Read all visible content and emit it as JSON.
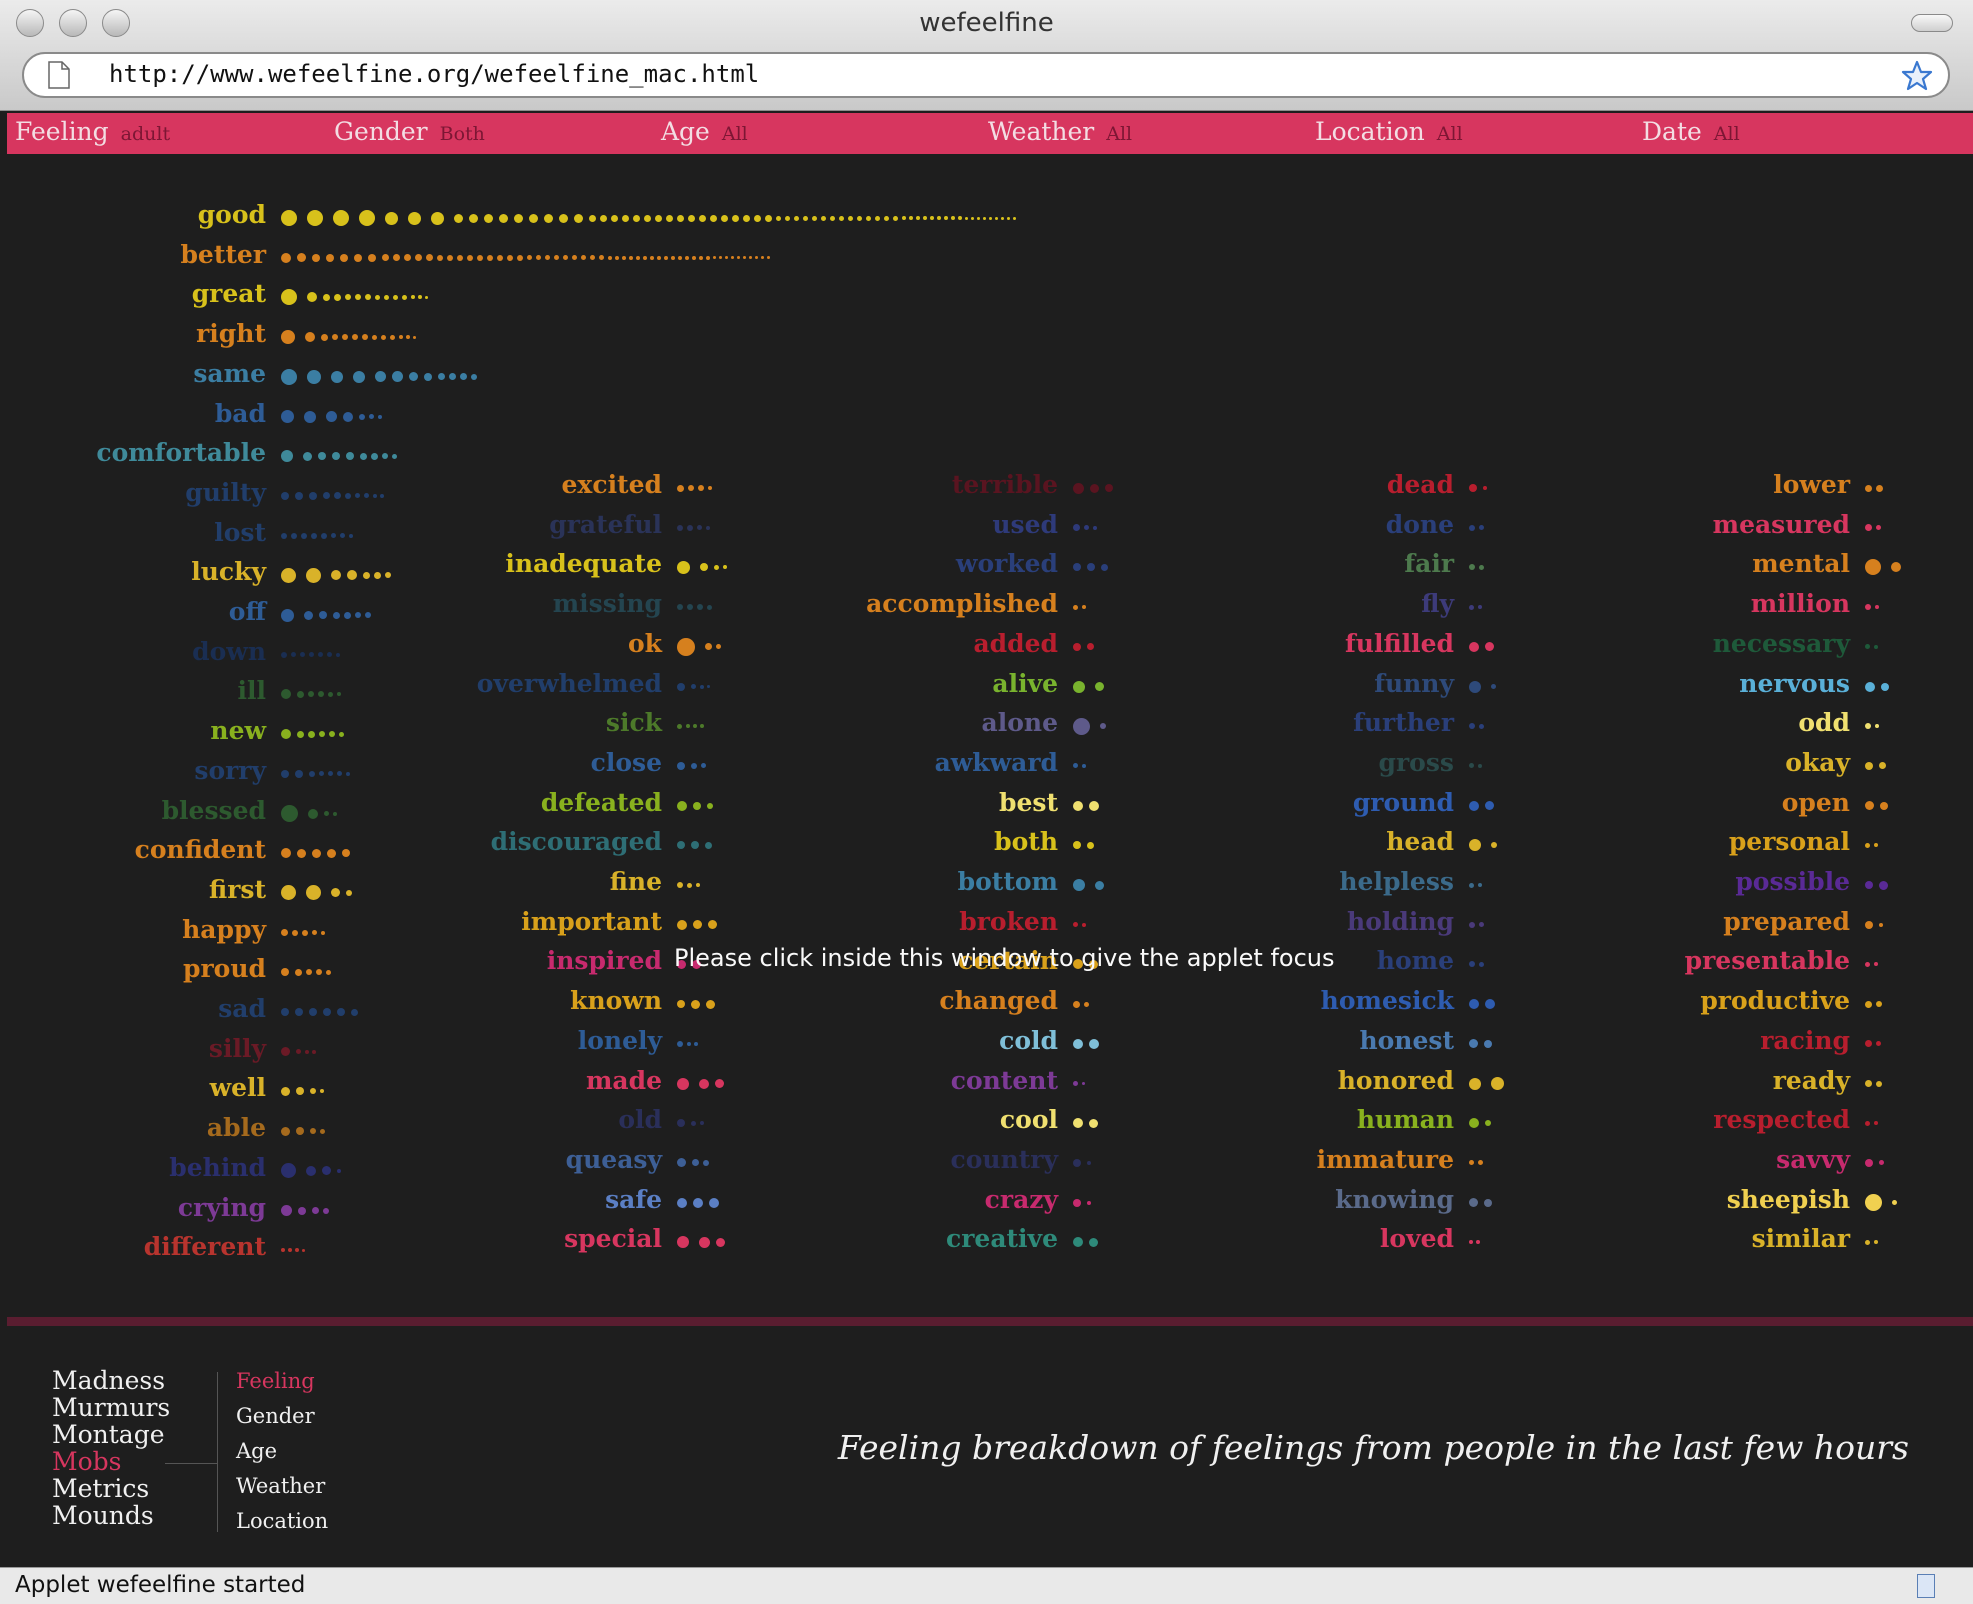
{
  "window": {
    "title": "wefeelfine",
    "url": "http://www.wefeelfine.org/wefeelfine_mac.html"
  },
  "filters": [
    {
      "label": "Feeling",
      "value": "adult"
    },
    {
      "label": "Gender",
      "value": "Both"
    },
    {
      "label": "Age",
      "value": "All"
    },
    {
      "label": "Weather",
      "value": "All"
    },
    {
      "label": "Location",
      "value": "All"
    },
    {
      "label": "Date",
      "value": "All"
    }
  ],
  "feelings": [
    {
      "word": "good",
      "color": "#d8c11b",
      "dots": [
        16,
        16,
        16,
        16,
        13,
        13,
        13,
        9,
        9,
        9,
        9,
        9,
        9,
        9,
        9,
        9,
        7,
        7,
        7,
        7,
        7,
        7,
        7,
        7,
        7,
        7,
        7,
        7,
        7,
        7,
        7,
        7,
        7,
        5,
        5,
        5,
        5,
        5,
        5,
        5,
        5,
        5,
        5,
        5,
        5,
        5,
        5,
        4,
        4,
        4,
        4,
        4,
        4,
        4,
        4,
        4,
        3,
        3,
        3,
        3,
        3,
        3,
        3,
        3,
        3
      ]
    },
    {
      "word": "better",
      "color": "#d6801e",
      "dots": [
        10,
        9,
        8,
        8,
        8,
        8,
        8,
        7,
        7,
        7,
        7,
        7,
        6,
        6,
        6,
        6,
        6,
        6,
        6,
        6,
        6,
        5,
        5,
        5,
        5,
        5,
        5,
        5,
        5,
        5,
        4,
        4,
        4,
        4,
        4,
        4,
        4,
        4,
        4,
        4,
        4,
        4,
        4,
        4,
        4,
        3,
        3,
        3,
        3,
        3,
        3,
        3,
        3,
        3,
        3
      ]
    },
    {
      "word": "great",
      "color": "#d8c11b",
      "dots": [
        16,
        10,
        7,
        7,
        6,
        6,
        6,
        5,
        5,
        5,
        5,
        4,
        4,
        3
      ]
    },
    {
      "word": "right",
      "color": "#d6801e",
      "dots": [
        14,
        10,
        7,
        6,
        6,
        6,
        6,
        5,
        5,
        5,
        4,
        4,
        3
      ]
    },
    {
      "word": "same",
      "color": "#3b7ea3",
      "dots": [
        16,
        14,
        12,
        12,
        11,
        11,
        9,
        8,
        7,
        7,
        7,
        6
      ]
    },
    {
      "word": "bad",
      "color": "#2e5c96",
      "dots": [
        13,
        12,
        11,
        10,
        6,
        5,
        4
      ]
    },
    {
      "word": "comfortable",
      "color": "#3f8a9a",
      "dots": [
        12,
        9,
        8,
        8,
        8,
        7,
        7,
        6,
        5
      ]
    },
    {
      "word": "guilty",
      "color": "#213e6b",
      "dots": [
        8,
        8,
        8,
        7,
        7,
        6,
        5,
        5,
        4,
        4
      ]
    },
    {
      "word": "lost",
      "color": "#213e6b",
      "dots": [
        6,
        6,
        6,
        6,
        6,
        5,
        5,
        4
      ]
    },
    {
      "word": "lucky",
      "color": "#d9b229",
      "dots": [
        15,
        15,
        10,
        10,
        7,
        7,
        6
      ]
    },
    {
      "word": "off",
      "color": "#2e5c96",
      "dots": [
        13,
        9,
        8,
        7,
        7,
        6,
        6
      ]
    },
    {
      "word": "down",
      "color": "#1a2e52",
      "dots": [
        6,
        5,
        5,
        5,
        5,
        5,
        4
      ]
    },
    {
      "word": "ill",
      "color": "#2d5a2f",
      "dots": [
        10,
        7,
        6,
        6,
        5,
        4
      ]
    },
    {
      "word": "new",
      "color": "#89b11e",
      "dots": [
        10,
        7,
        7,
        6,
        6,
        5
      ]
    },
    {
      "word": "sorry",
      "color": "#213e6b",
      "dots": [
        8,
        8,
        6,
        5,
        5,
        5,
        4
      ]
    },
    {
      "word": "blessed",
      "color": "#2d5a2f",
      "dots": [
        17,
        10,
        5,
        4
      ]
    },
    {
      "word": "confident",
      "color": "#d6801e",
      "dots": [
        10,
        9,
        9,
        9,
        8
      ]
    },
    {
      "word": "first",
      "color": "#d9b229",
      "dots": [
        15,
        15,
        9,
        6
      ]
    },
    {
      "word": "happy",
      "color": "#d6801e",
      "dots": [
        7,
        6,
        6,
        5,
        4
      ]
    },
    {
      "word": "proud",
      "color": "#d6801e",
      "dots": [
        8,
        7,
        6,
        6,
        5
      ]
    },
    {
      "word": "sad",
      "color": "#213e6b",
      "dots": [
        8,
        8,
        8,
        8,
        8,
        7
      ]
    },
    {
      "word": "silly",
      "color": "#6b1a26",
      "dots": [
        9,
        5,
        4,
        4
      ]
    },
    {
      "word": "well",
      "color": "#d9b229",
      "dots": [
        9,
        8,
        6,
        4
      ]
    },
    {
      "word": "able",
      "color": "#a56a1d",
      "dots": [
        9,
        8,
        6,
        5
      ]
    },
    {
      "word": "behind",
      "color": "#2a2f6e",
      "dots": [
        15,
        10,
        9,
        4
      ]
    },
    {
      "word": "crying",
      "color": "#7d3a96",
      "dots": [
        11,
        8,
        7,
        6
      ]
    },
    {
      "word": "different",
      "color": "#b8342e",
      "dots": [
        4,
        4,
        4,
        3
      ]
    },
    {
      "word": "excited",
      "color": "#d6801e",
      "dots": [
        7,
        6,
        6,
        4
      ]
    },
    {
      "word": "grateful",
      "color": "#2a3358",
      "dots": [
        6,
        6,
        5,
        4
      ]
    },
    {
      "word": "inadequate",
      "color": "#d8c11b",
      "dots": [
        13,
        8,
        5,
        4
      ]
    },
    {
      "word": "missing",
      "color": "#244550",
      "dots": [
        6,
        6,
        6,
        5
      ]
    },
    {
      "word": "ok",
      "color": "#d6801e",
      "dots": [
        18,
        7,
        5
      ]
    },
    {
      "word": "overwhelmed",
      "color": "#213e6b",
      "dots": [
        8,
        5,
        4,
        3
      ]
    },
    {
      "word": "sick",
      "color": "#4d7a2a",
      "dots": [
        5,
        4,
        4,
        4
      ]
    },
    {
      "word": "close",
      "color": "#2e5c96",
      "dots": [
        8,
        6,
        5
      ]
    },
    {
      "word": "defeated",
      "color": "#89b11e",
      "dots": [
        10,
        8,
        6
      ]
    },
    {
      "word": "discouraged",
      "color": "#2e6e75",
      "dots": [
        8,
        8,
        7
      ]
    },
    {
      "word": "fine",
      "color": "#d9b229",
      "dots": [
        6,
        5,
        4
      ]
    },
    {
      "word": "important",
      "color": "#d9a11b",
      "dots": [
        10,
        9,
        9
      ]
    },
    {
      "word": "inspired",
      "color": "#c72a6e",
      "dots": [
        9,
        9
      ]
    },
    {
      "word": "known",
      "color": "#d9a11b",
      "dots": [
        8,
        9,
        9
      ]
    },
    {
      "word": "lonely",
      "color": "#2e5c96",
      "dots": [
        6,
        4,
        4
      ]
    },
    {
      "word": "made",
      "color": "#d7365f",
      "dots": [
        12,
        10,
        9
      ]
    },
    {
      "word": "old",
      "color": "#2a2f5a",
      "dots": [
        8,
        5,
        4
      ]
    },
    {
      "word": "queasy",
      "color": "#3d5f96",
      "dots": [
        9,
        7,
        6
      ]
    },
    {
      "word": "safe",
      "color": "#5b7fc4",
      "dots": [
        10,
        10,
        10
      ]
    },
    {
      "word": "special",
      "color": "#d7365f",
      "dots": [
        12,
        11,
        9
      ]
    },
    {
      "word": "terrible",
      "color": "#5a1420",
      "dots": [
        11,
        9,
        8
      ]
    },
    {
      "word": "used",
      "color": "#2e3a7a",
      "dots": [
        7,
        5,
        4
      ]
    },
    {
      "word": "worked",
      "color": "#2a3f7a",
      "dots": [
        8,
        8,
        7
      ]
    },
    {
      "word": "accomplished",
      "color": "#d6801e",
      "dots": [
        5,
        4
      ]
    },
    {
      "word": "added",
      "color": "#b81e2e",
      "dots": [
        8,
        7
      ]
    },
    {
      "word": "alive",
      "color": "#79b32e",
      "dots": [
        12,
        9
      ]
    },
    {
      "word": "alone",
      "color": "#5e5a8a",
      "dots": [
        17,
        6
      ]
    },
    {
      "word": "awkward",
      "color": "#2e5c96",
      "dots": [
        5,
        4
      ]
    },
    {
      "word": "best",
      "color": "#f0e070",
      "dots": [
        10,
        10
      ]
    },
    {
      "word": "both",
      "color": "#d8c11b",
      "dots": [
        8,
        7
      ]
    },
    {
      "word": "bottom",
      "color": "#3b7ea3",
      "dots": [
        12,
        9
      ]
    },
    {
      "word": "broken",
      "color": "#b81e2e",
      "dots": [
        5,
        4
      ]
    },
    {
      "word": "certain",
      "color": "#d9a11b",
      "dots": [
        10,
        9
      ]
    },
    {
      "word": "changed",
      "color": "#d6801e",
      "dots": [
        7,
        5
      ]
    },
    {
      "word": "cold",
      "color": "#7fbfd8",
      "dots": [
        10,
        10
      ]
    },
    {
      "word": "content",
      "color": "#7d3a96",
      "dots": [
        5,
        3
      ]
    },
    {
      "word": "cool",
      "color": "#f0e070",
      "dots": [
        10,
        9
      ]
    },
    {
      "word": "country",
      "color": "#2a2f5a",
      "dots": [
        8,
        4
      ]
    },
    {
      "word": "crazy",
      "color": "#c72a6e",
      "dots": [
        8,
        4
      ]
    },
    {
      "word": "creative",
      "color": "#2e8a7a",
      "dots": [
        10,
        9
      ]
    },
    {
      "word": "dead",
      "color": "#b81e2e",
      "dots": [
        8,
        4
      ]
    },
    {
      "word": "done",
      "color": "#2a3f7a",
      "dots": [
        6,
        5
      ]
    },
    {
      "word": "fair",
      "color": "#4d7a4d",
      "dots": [
        6,
        5
      ]
    },
    {
      "word": "fly",
      "color": "#3d3b7a",
      "dots": [
        5,
        4
      ]
    },
    {
      "word": "fulfilled",
      "color": "#d7365f",
      "dots": [
        10,
        9
      ]
    },
    {
      "word": "funny",
      "color": "#2e4a7a",
      "dots": [
        12,
        5
      ]
    },
    {
      "word": "further",
      "color": "#2a3f7a",
      "dots": [
        6,
        5
      ]
    },
    {
      "word": "gross",
      "color": "#2a4a4a",
      "dots": [
        5,
        4
      ]
    },
    {
      "word": "ground",
      "color": "#2e5cb0",
      "dots": [
        10,
        9
      ]
    },
    {
      "word": "head",
      "color": "#d9b229",
      "dots": [
        12,
        6
      ]
    },
    {
      "word": "helpless",
      "color": "#3b6a8a",
      "dots": [
        5,
        4
      ]
    },
    {
      "word": "holding",
      "color": "#4a3a7a",
      "dots": [
        6,
        5
      ]
    },
    {
      "word": "home",
      "color": "#2a3f7a",
      "dots": [
        6,
        5
      ]
    },
    {
      "word": "homesick",
      "color": "#2e5cb0",
      "dots": [
        10,
        10
      ]
    },
    {
      "word": "honest",
      "color": "#4a7ab0",
      "dots": [
        9,
        8
      ]
    },
    {
      "word": "honored",
      "color": "#d9b229",
      "dots": [
        12,
        13
      ]
    },
    {
      "word": "human",
      "color": "#89b11e",
      "dots": [
        10,
        6
      ]
    },
    {
      "word": "immature",
      "color": "#d6801e",
      "dots": [
        5,
        5
      ]
    },
    {
      "word": "knowing",
      "color": "#5a6a8a",
      "dots": [
        9,
        8
      ]
    },
    {
      "word": "loved",
      "color": "#d7365f",
      "dots": [
        4,
        4
      ]
    },
    {
      "word": "lower",
      "color": "#d6801e",
      "dots": [
        7,
        7
      ]
    },
    {
      "word": "measured",
      "color": "#d7365f",
      "dots": [
        7,
        5
      ]
    },
    {
      "word": "mental",
      "color": "#d6801e",
      "dots": [
        16,
        10
      ]
    },
    {
      "word": "million",
      "color": "#d7365f",
      "dots": [
        6,
        4
      ]
    },
    {
      "word": "necessary",
      "color": "#1e5a3a",
      "dots": [
        5,
        4
      ]
    },
    {
      "word": "nervous",
      "color": "#5ab0d8",
      "dots": [
        10,
        8
      ]
    },
    {
      "word": "odd",
      "color": "#f0e070",
      "dots": [
        6,
        4
      ]
    },
    {
      "word": "okay",
      "color": "#d9b229",
      "dots": [
        8,
        7
      ]
    },
    {
      "word": "open",
      "color": "#d6801e",
      "dots": [
        9,
        8
      ]
    },
    {
      "word": "personal",
      "color": "#d9a11b",
      "dots": [
        5,
        4
      ]
    },
    {
      "word": "possible",
      "color": "#5a2a96",
      "dots": [
        8,
        9
      ]
    },
    {
      "word": "prepared",
      "color": "#d6801e",
      "dots": [
        8,
        4
      ]
    },
    {
      "word": "presentable",
      "color": "#d7365f",
      "dots": [
        5,
        4
      ]
    },
    {
      "word": "productive",
      "color": "#d9a11b",
      "dots": [
        7,
        6
      ]
    },
    {
      "word": "racing",
      "color": "#b81e2e",
      "dots": [
        7,
        5
      ]
    },
    {
      "word": "ready",
      "color": "#d9b229",
      "dots": [
        7,
        6
      ]
    },
    {
      "word": "respected",
      "color": "#b81e2e",
      "dots": [
        5,
        4
      ]
    },
    {
      "word": "savvy",
      "color": "#c72a6e",
      "dots": [
        8,
        5
      ]
    },
    {
      "word": "sheepish",
      "color": "#f0d050",
      "dots": [
        17,
        5
      ]
    },
    {
      "word": "similar",
      "color": "#d9b229",
      "dots": [
        5,
        4
      ]
    }
  ],
  "focus_message": "Please click inside this window to give the applet focus",
  "nav_primary": [
    {
      "label": "Madness",
      "active": false
    },
    {
      "label": "Murmurs",
      "active": false
    },
    {
      "label": "Montage",
      "active": false
    },
    {
      "label": "Mobs",
      "active": true
    },
    {
      "label": "Metrics",
      "active": false
    },
    {
      "label": "Mounds",
      "active": false
    }
  ],
  "nav_secondary": [
    {
      "label": "Feeling",
      "active": true
    },
    {
      "label": "Gender",
      "active": false
    },
    {
      "label": "Age",
      "active": false
    },
    {
      "label": "Weather",
      "active": false
    },
    {
      "label": "Location",
      "active": false
    }
  ],
  "caption": "Feeling breakdown of feelings from people in the last few hours",
  "status": "Applet wefeelfine started"
}
